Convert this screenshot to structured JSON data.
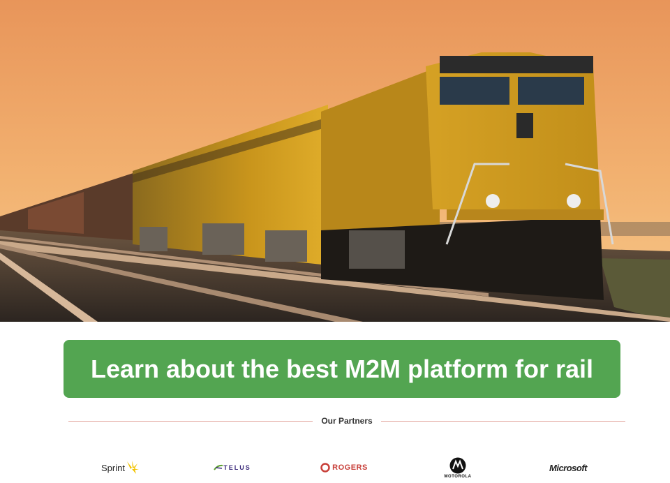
{
  "hero": {
    "alt": "freight train locomotives at sunset"
  },
  "cta": {
    "label": "Learn about the best M2M platform for rail"
  },
  "partners": {
    "heading": "Our Partners",
    "logos": [
      {
        "name": "Sprint",
        "text": "Sprint",
        "color": "#f2c300"
      },
      {
        "name": "TELUS",
        "text": "TELUS",
        "color": "#3b2a7a"
      },
      {
        "name": "ROGERS",
        "text": "ROGERS",
        "color": "#c8403a"
      },
      {
        "name": "MOTOROLA",
        "text": "MOTOROLA",
        "color": "#111111"
      },
      {
        "name": "Microsoft",
        "text": "Microsoft",
        "color": "#222222"
      }
    ]
  },
  "colors": {
    "cta_bg": "#53a551",
    "rule": "#e4a79e",
    "sky_top": "#e89a58",
    "locomotive": "#d8a11e"
  }
}
